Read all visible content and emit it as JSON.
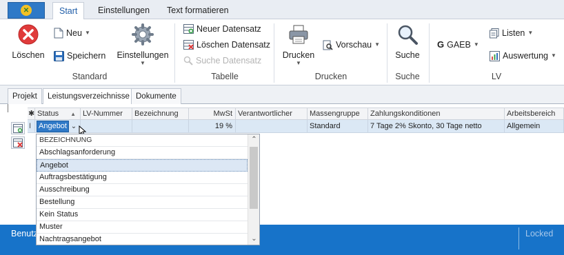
{
  "ribbon_tabs": {
    "start": "Start",
    "einstellungen": "Einstellungen",
    "text_formatieren": "Text formatieren"
  },
  "groups": {
    "standard": {
      "label": "Standard",
      "loeschen": "Löschen",
      "neu": "Neu",
      "speichern": "Speichern",
      "einstellungen": "Einstellungen"
    },
    "tabelle": {
      "label": "Tabelle",
      "neuer_datensatz": "Neuer Datensatz",
      "loeschen_datensatz": "Löschen Datensatz",
      "suche_datensatz": "Suche Datensatz"
    },
    "drucken": {
      "label": "Drucken",
      "drucken": "Drucken",
      "vorschau": "Vorschau"
    },
    "suche": {
      "label": "Suche",
      "suche": "Suche"
    },
    "lv": {
      "label": "LV",
      "gaeb": "GAEB",
      "listen": "Listen",
      "auswertung": "Auswertung"
    }
  },
  "doc_tabs": {
    "projekt": "Projekt",
    "leistungsverzeichnisse": "Leistungsverzeichnisse",
    "dokumente": "Dokumente"
  },
  "grid": {
    "columns": {
      "status": "Status",
      "lv_nummer": "LV-Nummer",
      "bezeichnung": "Bezeichnung",
      "mwst": "MwSt",
      "verantwortlicher": "Verantwortlicher",
      "massengruppe": "Massengruppe",
      "zahlungskonditionen": "Zahlungskonditionen",
      "arbeitsbereich": "Arbeitsbereich"
    },
    "row": {
      "status": "Angebot",
      "lv_nummer": "",
      "bezeichnung": "",
      "mwst": "19 %",
      "verantwortlicher": "",
      "massengruppe": "Standard",
      "zahlungskonditionen": "7 Tage 2% Skonto, 30 Tage netto",
      "arbeitsbereich": "Allgemein"
    }
  },
  "dropdown": {
    "header": "BEZEICHNUNG",
    "options": [
      "Abschlagsanforderung",
      "Angebot",
      "Auftragsbestätigung",
      "Ausschreibung",
      "Bestellung",
      "Kein Status",
      "Muster",
      "Nachtragsangebot"
    ],
    "selected": "Angebot"
  },
  "statusbar": {
    "left": "Benutz",
    "right": "Locked"
  },
  "colors": {
    "accent": "#1773c9",
    "delete_red": "#e03b3b",
    "selection": "#dbe8f5"
  }
}
